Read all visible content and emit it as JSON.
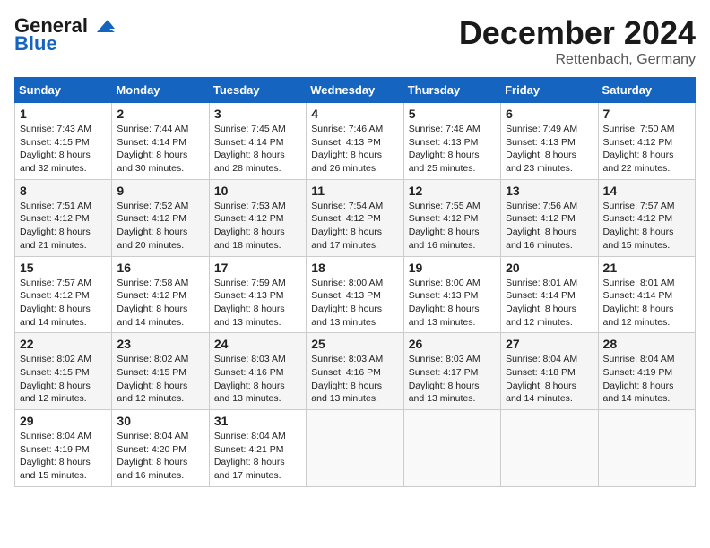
{
  "header": {
    "logo_general": "General",
    "logo_blue": "Blue",
    "month_title": "December 2024",
    "location": "Rettenbach, Germany"
  },
  "days_of_week": [
    "Sunday",
    "Monday",
    "Tuesday",
    "Wednesday",
    "Thursday",
    "Friday",
    "Saturday"
  ],
  "weeks": [
    [
      {
        "day": 1,
        "sunrise": "Sunrise: 7:43 AM",
        "sunset": "Sunset: 4:15 PM",
        "daylight": "Daylight: 8 hours and 32 minutes."
      },
      {
        "day": 2,
        "sunrise": "Sunrise: 7:44 AM",
        "sunset": "Sunset: 4:14 PM",
        "daylight": "Daylight: 8 hours and 30 minutes."
      },
      {
        "day": 3,
        "sunrise": "Sunrise: 7:45 AM",
        "sunset": "Sunset: 4:14 PM",
        "daylight": "Daylight: 8 hours and 28 minutes."
      },
      {
        "day": 4,
        "sunrise": "Sunrise: 7:46 AM",
        "sunset": "Sunset: 4:13 PM",
        "daylight": "Daylight: 8 hours and 26 minutes."
      },
      {
        "day": 5,
        "sunrise": "Sunrise: 7:48 AM",
        "sunset": "Sunset: 4:13 PM",
        "daylight": "Daylight: 8 hours and 25 minutes."
      },
      {
        "day": 6,
        "sunrise": "Sunrise: 7:49 AM",
        "sunset": "Sunset: 4:13 PM",
        "daylight": "Daylight: 8 hours and 23 minutes."
      },
      {
        "day": 7,
        "sunrise": "Sunrise: 7:50 AM",
        "sunset": "Sunset: 4:12 PM",
        "daylight": "Daylight: 8 hours and 22 minutes."
      }
    ],
    [
      {
        "day": 8,
        "sunrise": "Sunrise: 7:51 AM",
        "sunset": "Sunset: 4:12 PM",
        "daylight": "Daylight: 8 hours and 21 minutes."
      },
      {
        "day": 9,
        "sunrise": "Sunrise: 7:52 AM",
        "sunset": "Sunset: 4:12 PM",
        "daylight": "Daylight: 8 hours and 20 minutes."
      },
      {
        "day": 10,
        "sunrise": "Sunrise: 7:53 AM",
        "sunset": "Sunset: 4:12 PM",
        "daylight": "Daylight: 8 hours and 18 minutes."
      },
      {
        "day": 11,
        "sunrise": "Sunrise: 7:54 AM",
        "sunset": "Sunset: 4:12 PM",
        "daylight": "Daylight: 8 hours and 17 minutes."
      },
      {
        "day": 12,
        "sunrise": "Sunrise: 7:55 AM",
        "sunset": "Sunset: 4:12 PM",
        "daylight": "Daylight: 8 hours and 16 minutes."
      },
      {
        "day": 13,
        "sunrise": "Sunrise: 7:56 AM",
        "sunset": "Sunset: 4:12 PM",
        "daylight": "Daylight: 8 hours and 16 minutes."
      },
      {
        "day": 14,
        "sunrise": "Sunrise: 7:57 AM",
        "sunset": "Sunset: 4:12 PM",
        "daylight": "Daylight: 8 hours and 15 minutes."
      }
    ],
    [
      {
        "day": 15,
        "sunrise": "Sunrise: 7:57 AM",
        "sunset": "Sunset: 4:12 PM",
        "daylight": "Daylight: 8 hours and 14 minutes."
      },
      {
        "day": 16,
        "sunrise": "Sunrise: 7:58 AM",
        "sunset": "Sunset: 4:12 PM",
        "daylight": "Daylight: 8 hours and 14 minutes."
      },
      {
        "day": 17,
        "sunrise": "Sunrise: 7:59 AM",
        "sunset": "Sunset: 4:13 PM",
        "daylight": "Daylight: 8 hours and 13 minutes."
      },
      {
        "day": 18,
        "sunrise": "Sunrise: 8:00 AM",
        "sunset": "Sunset: 4:13 PM",
        "daylight": "Daylight: 8 hours and 13 minutes."
      },
      {
        "day": 19,
        "sunrise": "Sunrise: 8:00 AM",
        "sunset": "Sunset: 4:13 PM",
        "daylight": "Daylight: 8 hours and 13 minutes."
      },
      {
        "day": 20,
        "sunrise": "Sunrise: 8:01 AM",
        "sunset": "Sunset: 4:14 PM",
        "daylight": "Daylight: 8 hours and 12 minutes."
      },
      {
        "day": 21,
        "sunrise": "Sunrise: 8:01 AM",
        "sunset": "Sunset: 4:14 PM",
        "daylight": "Daylight: 8 hours and 12 minutes."
      }
    ],
    [
      {
        "day": 22,
        "sunrise": "Sunrise: 8:02 AM",
        "sunset": "Sunset: 4:15 PM",
        "daylight": "Daylight: 8 hours and 12 minutes."
      },
      {
        "day": 23,
        "sunrise": "Sunrise: 8:02 AM",
        "sunset": "Sunset: 4:15 PM",
        "daylight": "Daylight: 8 hours and 12 minutes."
      },
      {
        "day": 24,
        "sunrise": "Sunrise: 8:03 AM",
        "sunset": "Sunset: 4:16 PM",
        "daylight": "Daylight: 8 hours and 13 minutes."
      },
      {
        "day": 25,
        "sunrise": "Sunrise: 8:03 AM",
        "sunset": "Sunset: 4:16 PM",
        "daylight": "Daylight: 8 hours and 13 minutes."
      },
      {
        "day": 26,
        "sunrise": "Sunrise: 8:03 AM",
        "sunset": "Sunset: 4:17 PM",
        "daylight": "Daylight: 8 hours and 13 minutes."
      },
      {
        "day": 27,
        "sunrise": "Sunrise: 8:04 AM",
        "sunset": "Sunset: 4:18 PM",
        "daylight": "Daylight: 8 hours and 14 minutes."
      },
      {
        "day": 28,
        "sunrise": "Sunrise: 8:04 AM",
        "sunset": "Sunset: 4:19 PM",
        "daylight": "Daylight: 8 hours and 14 minutes."
      }
    ],
    [
      {
        "day": 29,
        "sunrise": "Sunrise: 8:04 AM",
        "sunset": "Sunset: 4:19 PM",
        "daylight": "Daylight: 8 hours and 15 minutes."
      },
      {
        "day": 30,
        "sunrise": "Sunrise: 8:04 AM",
        "sunset": "Sunset: 4:20 PM",
        "daylight": "Daylight: 8 hours and 16 minutes."
      },
      {
        "day": 31,
        "sunrise": "Sunrise: 8:04 AM",
        "sunset": "Sunset: 4:21 PM",
        "daylight": "Daylight: 8 hours and 17 minutes."
      },
      null,
      null,
      null,
      null
    ]
  ]
}
